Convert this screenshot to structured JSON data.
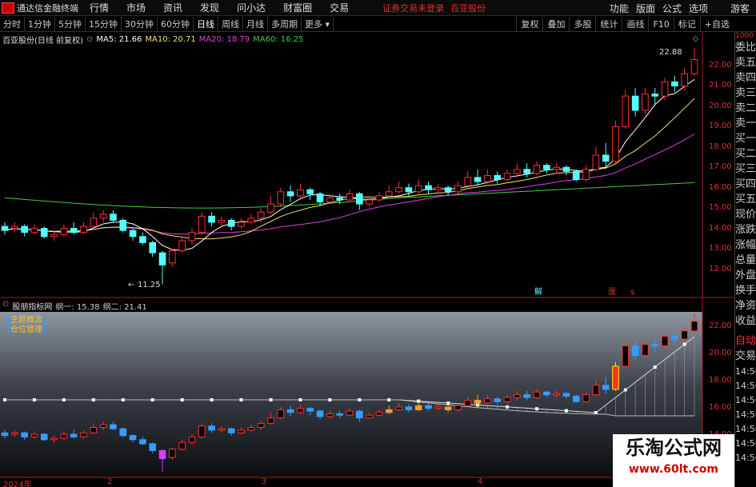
{
  "menubar": {
    "app_title": "通达信金融终端",
    "items": [
      "行情",
      "市场",
      "资讯",
      "发现",
      "问小达",
      "财富圈",
      "交易"
    ],
    "notice": "证券交易未登录",
    "stock_name": "百亚股份",
    "right_items": [
      "功能",
      "版面",
      "公式",
      "选项",
      "画线",
      "标记",
      "+自选"
    ],
    "guest": "游客"
  },
  "tabs": [
    "分时",
    "1分钟",
    "5分钟",
    "15分钟",
    "30分钟",
    "60分钟",
    "日线",
    "周线",
    "月线",
    "多周期",
    "更多"
  ],
  "active_tab": "日线",
  "tab_right": [
    "复权",
    "叠加",
    "多股",
    "统计",
    "画线",
    "F10",
    "标记",
    "+自选"
  ],
  "side": {
    "top": "1000",
    "items": [
      "委比",
      "卖五",
      "卖四",
      "卖三",
      "卖二",
      "卖一",
      "买一",
      "买二",
      "买三",
      "买四",
      "买五",
      "现价",
      "涨跌",
      "涨幅",
      "总量",
      "外盘",
      "换手",
      "净资",
      "收益",
      "",
      "自动",
      "交易",
      "14:56",
      "14:56",
      "14:56",
      "14:56",
      "14:56",
      "14:56",
      "14:56"
    ]
  },
  "main_panel": {
    "title": "百亚股份(日线 前复权)",
    "ma5": "MA5: 21.66",
    "ma10": "MA10: 20.71",
    "ma20": "MA20: 18.79",
    "ma60": "MA60: 16.25",
    "high_label": "22.88",
    "low_label": "11.25",
    "signal_jie": "解",
    "signal_zhang": "涨",
    "signal_s": "s"
  },
  "sub_panel": {
    "title": "股朋指标网",
    "line1": "纲一: 15.38",
    "line2": "纲二: 21.41",
    "tag1": "主题概念",
    "tag2": "仓位管理"
  },
  "main_axis": [
    "22.00",
    "21.00",
    "20.00",
    "19.00",
    "18.00",
    "17.00",
    "16.00",
    "15.00",
    "14.00",
    "13.00",
    "12.00"
  ],
  "sub_axis": [
    "22.00",
    "20.00",
    "18.00",
    "16.00",
    "14.00"
  ],
  "x_ticks": [
    "2024年",
    "2",
    "3",
    "4"
  ],
  "watermark": {
    "line1": "乐淘公式网",
    "line2": "www.60lt.com"
  },
  "colors": {
    "up": "#ff3030",
    "down": "#54ffff",
    "ma5": "#ffffff",
    "ma10": "#f0e070",
    "ma20": "#e040e0",
    "ma60": "#40d040",
    "axis": "#e03030"
  },
  "chart_data": {
    "type": "candlestick",
    "ylim": [
      11,
      23
    ],
    "candles": [
      [
        14.1,
        13.9,
        14.3,
        13.7
      ],
      [
        14.0,
        14.1,
        14.3,
        13.8
      ],
      [
        14.1,
        13.8,
        14.2,
        13.6
      ],
      [
        13.8,
        14.0,
        14.2,
        13.7
      ],
      [
        14.0,
        13.6,
        14.1,
        13.5
      ],
      [
        13.6,
        13.7,
        13.9,
        13.4
      ],
      [
        13.7,
        14.0,
        14.2,
        13.6
      ],
      [
        14.0,
        13.8,
        14.3,
        13.7
      ],
      [
        13.8,
        14.1,
        14.3,
        13.7
      ],
      [
        14.1,
        14.5,
        14.8,
        14.0
      ],
      [
        14.5,
        14.7,
        14.9,
        14.3
      ],
      [
        14.7,
        14.4,
        14.9,
        14.3
      ],
      [
        14.4,
        13.9,
        14.5,
        13.8
      ],
      [
        13.9,
        13.6,
        14.0,
        13.4
      ],
      [
        13.6,
        13.3,
        13.8,
        13.2
      ],
      [
        13.3,
        12.8,
        13.4,
        12.6
      ],
      [
        12.8,
        12.2,
        12.9,
        11.25
      ],
      [
        12.3,
        12.9,
        13.0,
        12.1
      ],
      [
        12.9,
        13.4,
        13.6,
        12.8
      ],
      [
        13.4,
        13.8,
        14.0,
        13.2
      ],
      [
        13.8,
        14.6,
        14.8,
        13.7
      ],
      [
        14.6,
        14.3,
        14.8,
        14.1
      ],
      [
        14.3,
        14.4,
        14.6,
        14.1
      ],
      [
        14.4,
        14.1,
        14.5,
        13.9
      ],
      [
        14.1,
        14.3,
        14.5,
        14.0
      ],
      [
        14.3,
        14.5,
        14.7,
        14.2
      ],
      [
        14.5,
        14.8,
        15.0,
        14.3
      ],
      [
        14.8,
        15.2,
        15.6,
        14.7
      ],
      [
        15.2,
        15.8,
        16.0,
        15.1
      ],
      [
        15.8,
        15.6,
        16.1,
        15.3
      ],
      [
        15.6,
        15.9,
        16.2,
        15.5
      ],
      [
        15.9,
        15.7,
        16.0,
        15.4
      ],
      [
        15.7,
        15.3,
        15.8,
        15.1
      ],
      [
        15.3,
        15.5,
        15.7,
        15.2
      ],
      [
        15.5,
        15.4,
        15.7,
        15.2
      ],
      [
        15.4,
        15.7,
        15.9,
        15.3
      ],
      [
        15.7,
        15.2,
        15.8,
        14.9
      ],
      [
        15.2,
        15.4,
        15.6,
        15.1
      ],
      [
        15.4,
        15.6,
        15.8,
        15.3
      ],
      [
        15.6,
        15.8,
        16.1,
        15.5
      ],
      [
        15.8,
        16.0,
        16.3,
        15.7
      ],
      [
        16.0,
        15.8,
        16.2,
        15.6
      ],
      [
        15.8,
        16.1,
        16.4,
        15.7
      ],
      [
        16.1,
        15.9,
        16.3,
        15.7
      ],
      [
        15.9,
        16.0,
        16.2,
        15.8
      ],
      [
        16.0,
        15.8,
        16.1,
        15.6
      ],
      [
        15.8,
        16.1,
        16.3,
        15.7
      ],
      [
        16.1,
        16.5,
        16.8,
        16.0
      ],
      [
        16.5,
        16.3,
        16.9,
        16.1
      ],
      [
        16.3,
        16.6,
        16.9,
        16.2
      ],
      [
        16.6,
        16.4,
        16.8,
        16.2
      ],
      [
        16.4,
        16.7,
        16.9,
        16.3
      ],
      [
        16.7,
        16.9,
        17.2,
        16.5
      ],
      [
        16.9,
        16.7,
        17.2,
        16.5
      ],
      [
        16.7,
        17.1,
        17.3,
        16.6
      ],
      [
        17.1,
        16.9,
        17.2,
        16.7
      ],
      [
        16.9,
        17.0,
        17.2,
        16.7
      ],
      [
        17.0,
        16.8,
        17.1,
        16.6
      ],
      [
        16.8,
        16.4,
        16.9,
        16.3
      ],
      [
        16.4,
        16.9,
        17.1,
        16.3
      ],
      [
        16.9,
        17.6,
        18.0,
        16.8
      ],
      [
        17.6,
        17.3,
        18.2,
        17.0
      ],
      [
        17.3,
        19.0,
        19.3,
        17.2
      ],
      [
        19.0,
        20.5,
        20.8,
        18.9
      ],
      [
        20.5,
        19.8,
        20.9,
        19.5
      ],
      [
        19.8,
        20.6,
        20.9,
        19.6
      ],
      [
        20.6,
        20.5,
        20.9,
        20.1
      ],
      [
        20.5,
        21.2,
        21.4,
        20.3
      ],
      [
        21.2,
        21.0,
        21.5,
        20.7
      ],
      [
        21.0,
        21.6,
        21.9,
        20.8
      ],
      [
        21.6,
        22.3,
        22.88,
        21.5
      ]
    ]
  }
}
